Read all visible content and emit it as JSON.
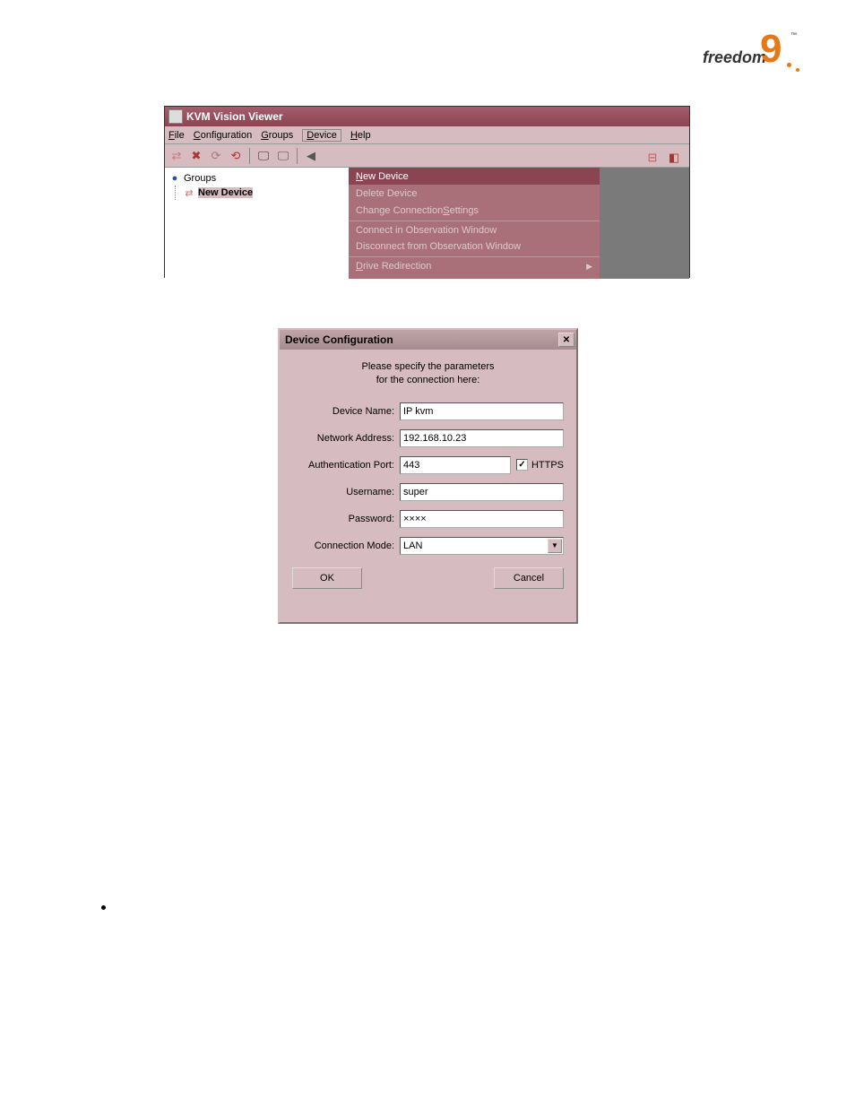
{
  "logo": {
    "text": "freedom",
    "digit": "9",
    "tm": "™"
  },
  "win1": {
    "title": "KVM Vision Viewer",
    "menu": {
      "file": "File",
      "configuration": "Configuration",
      "groups": "Groups",
      "device": "Device",
      "help": "Help"
    },
    "tree": {
      "root": "Groups",
      "child": "New Device"
    },
    "dropdown": {
      "new_device": "New Device",
      "delete_device": "Delete Device",
      "change_settings": "Change Connection Settings",
      "connect_obs": "Connect in Observation Window",
      "disconnect_obs": "Disconnect from Observation Window",
      "drive_redir": "Drive Redirection"
    }
  },
  "dlg": {
    "title": "Device Configuration",
    "close": "✕",
    "msg1": "Please specify the parameters",
    "msg2": "for the connection here:",
    "labels": {
      "device_name": "Device Name:",
      "network_address": "Network Address:",
      "auth_port": "Authentication Port:",
      "https": "HTTPS",
      "username": "Username:",
      "password": "Password:",
      "conn_mode": "Connection Mode:"
    },
    "values": {
      "device_name": "IP kvm",
      "network_address": "192.168.10.23",
      "auth_port": "443",
      "https_checked": "✓",
      "username": "super",
      "password": "××××",
      "conn_mode": "LAN"
    },
    "buttons": {
      "ok": "OK",
      "cancel": "Cancel"
    }
  }
}
